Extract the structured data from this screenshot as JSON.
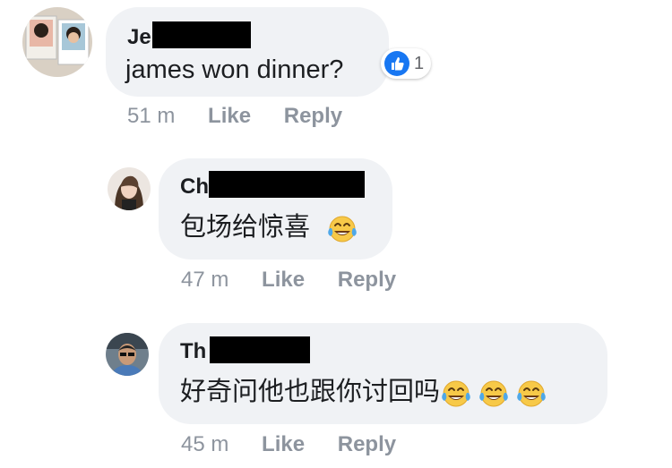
{
  "comments": [
    {
      "author_visible": "Je",
      "text": "james won dinner?",
      "time": "51 m",
      "like_label": "Like",
      "reply_label": "Reply",
      "reaction_count": "1",
      "reaction_icon": "like-icon"
    },
    {
      "author_visible": "Ch",
      "text": "包场给惊喜",
      "emoji": [
        "laughing-tears-emoji"
      ],
      "time": "47 m",
      "like_label": "Like",
      "reply_label": "Reply"
    },
    {
      "author_visible": "Th",
      "text": "好奇问他也跟你讨回吗",
      "emoji": [
        "laughing-tears-emoji",
        "laughing-tears-emoji",
        "laughing-tears-emoji"
      ],
      "time": "45 m",
      "like_label": "Like",
      "reply_label": "Reply"
    }
  ],
  "colors": {
    "bubble": "#f0f2f5",
    "meta_text": "#8d949e",
    "like_blue": "#1877f2",
    "redaction": "#000000"
  }
}
